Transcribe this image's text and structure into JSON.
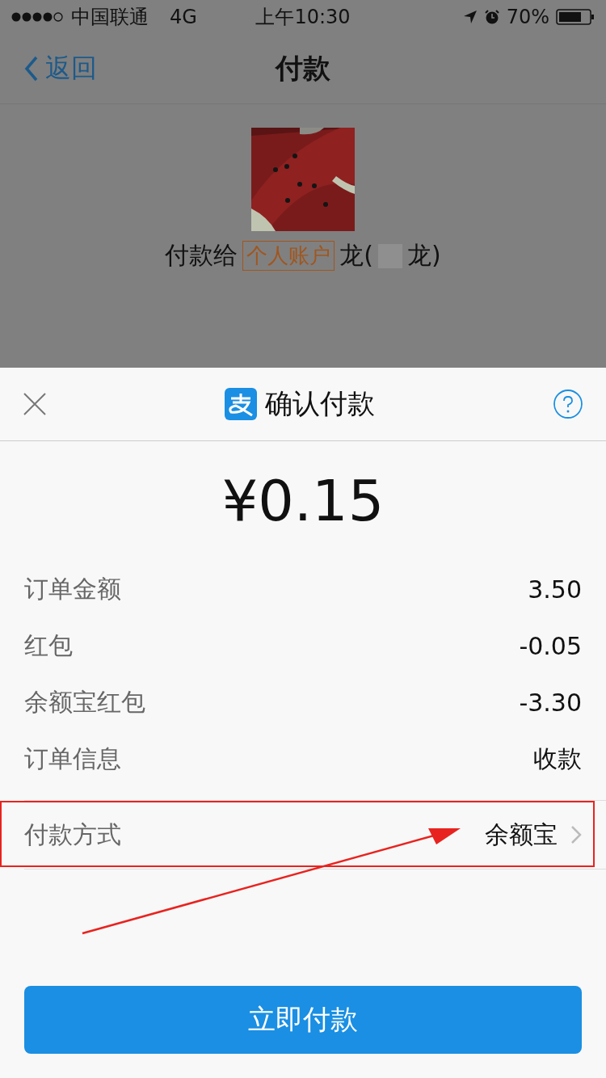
{
  "status_bar": {
    "carrier": "中国联通",
    "network": "4G",
    "time": "上午10:30",
    "battery": "70%"
  },
  "nav": {
    "back": "返回",
    "title": "付款"
  },
  "payee": {
    "prefix": "付款给",
    "tag": "个人账户",
    "name_start": "龙(",
    "name_end": "龙)"
  },
  "sheet": {
    "title": "确认付款",
    "amount": "¥0.15",
    "rows": [
      {
        "label": "订单金额",
        "value": "3.50"
      },
      {
        "label": "红包",
        "value": "-0.05"
      },
      {
        "label": "余额宝红包",
        "value": "-3.30"
      },
      {
        "label": "订单信息",
        "value": "收款"
      }
    ],
    "payment_method": {
      "label": "付款方式",
      "value": "余额宝",
      "highlighted": true
    },
    "button": "立即付款"
  }
}
